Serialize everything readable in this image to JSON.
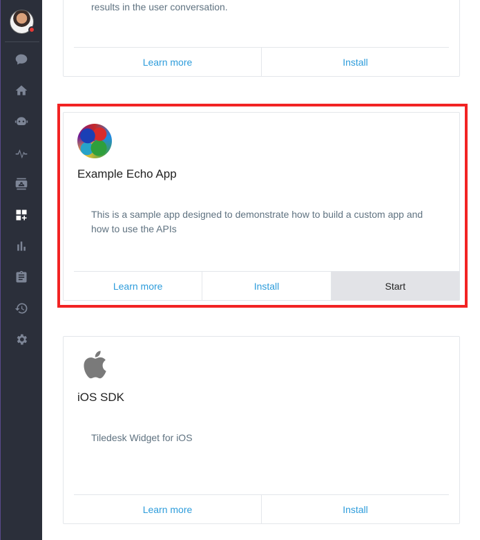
{
  "sidebar": {
    "nav": [
      {
        "name": "chat-icon"
      },
      {
        "name": "home-icon"
      },
      {
        "name": "bot-icon"
      },
      {
        "name": "activity-icon"
      },
      {
        "name": "contacts-icon"
      },
      {
        "name": "apps-icon"
      },
      {
        "name": "analytics-icon"
      },
      {
        "name": "clipboard-icon"
      },
      {
        "name": "history-icon"
      },
      {
        "name": "settings-icon"
      }
    ]
  },
  "cards": [
    {
      "description_tail": "results in the user conversation.",
      "learn_more": "Learn more",
      "install": "Install"
    },
    {
      "title": "Example Echo App",
      "description": "This is a sample app designed to demonstrate how to build a custom app and how to use the APIs",
      "learn_more": "Learn more",
      "install": "Install",
      "start": "Start"
    },
    {
      "title": "iOS SDK",
      "description": "Tiledesk Widget for iOS",
      "learn_more": "Learn more",
      "install": "Install"
    }
  ],
  "colors": {
    "sidebar_bg": "#2b2f3a",
    "link": "#2d9cdb",
    "highlight": "#f22323"
  }
}
